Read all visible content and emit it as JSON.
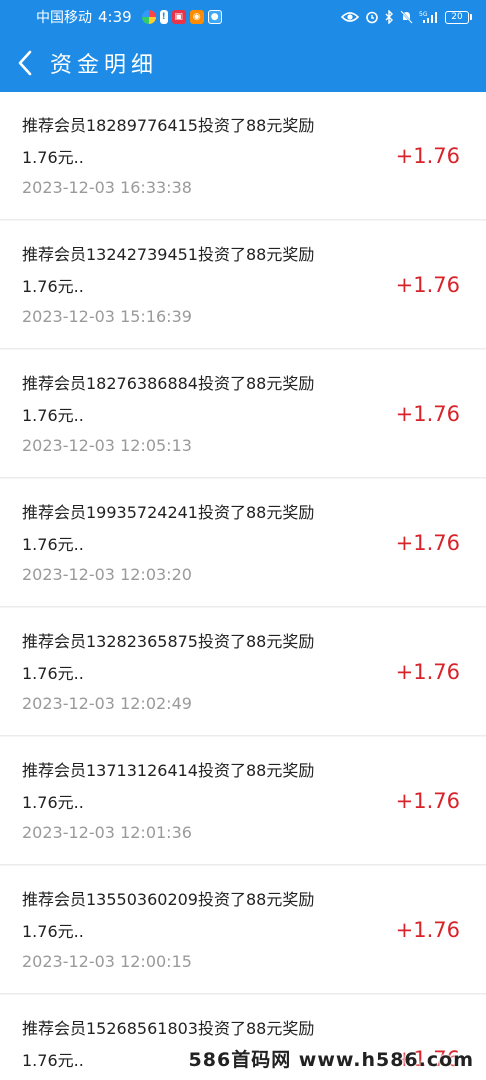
{
  "status_bar": {
    "carrier": "中国移动",
    "time": "4:39",
    "network": "5G",
    "battery": "20"
  },
  "header": {
    "title": "资金明细"
  },
  "records": [
    {
      "desc_line1": "推荐会员18289776415投资了88元奖励",
      "desc_line2": "1.76元..",
      "time": "2023-12-03 16:33:38",
      "amount": "+1.76"
    },
    {
      "desc_line1": "推荐会员13242739451投资了88元奖励",
      "desc_line2": "1.76元..",
      "time": "2023-12-03 15:16:39",
      "amount": "+1.76"
    },
    {
      "desc_line1": "推荐会员18276386884投资了88元奖励",
      "desc_line2": "1.76元..",
      "time": "2023-12-03 12:05:13",
      "amount": "+1.76"
    },
    {
      "desc_line1": "推荐会员19935724241投资了88元奖励",
      "desc_line2": "1.76元..",
      "time": "2023-12-03 12:03:20",
      "amount": "+1.76"
    },
    {
      "desc_line1": "推荐会员13282365875投资了88元奖励",
      "desc_line2": "1.76元..",
      "time": "2023-12-03 12:02:49",
      "amount": "+1.76"
    },
    {
      "desc_line1": "推荐会员13713126414投资了88元奖励",
      "desc_line2": "1.76元..",
      "time": "2023-12-03 12:01:36",
      "amount": "+1.76"
    },
    {
      "desc_line1": "推荐会员13550360209投资了88元奖励",
      "desc_line2": "1.76元..",
      "time": "2023-12-03 12:00:15",
      "amount": "+1.76"
    },
    {
      "desc_line1": "推荐会员15268561803投资了88元奖励",
      "desc_line2": "1.76元..",
      "time": "",
      "amount": "+1.76"
    }
  ],
  "watermark": "586首码网 www.h586.com",
  "colors": {
    "header_bg": "#1e8ce6",
    "amount": "#d8232a",
    "time_text": "#9a9a9a"
  }
}
